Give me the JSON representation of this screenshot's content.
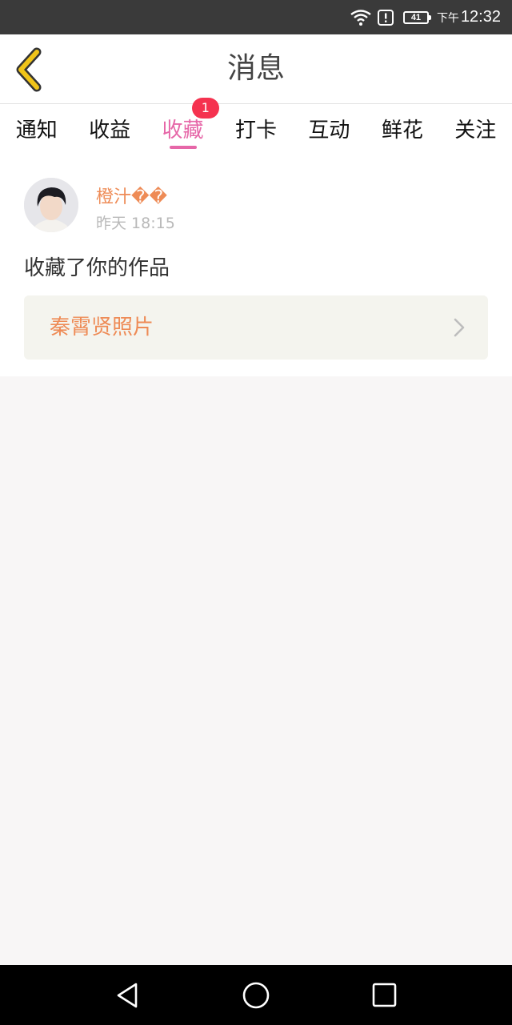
{
  "status_bar": {
    "battery": "41",
    "time_prefix": "下午",
    "time": "12:32",
    "icons": [
      "wifi-icon",
      "alert-icon",
      "battery-icon"
    ]
  },
  "header": {
    "title": "消息",
    "back_icon": "chevron-left-icon"
  },
  "tabs": [
    {
      "label": "通知"
    },
    {
      "label": "收益"
    },
    {
      "label": "收藏",
      "active": true,
      "badge": "1"
    },
    {
      "label": "打卡"
    },
    {
      "label": "互动"
    },
    {
      "label": "鲜花"
    },
    {
      "label": "关注"
    }
  ],
  "message": {
    "username": "橙汁��",
    "time": "昨天 18:15",
    "action": "收藏了你的作品",
    "work_title": "秦霄贤照片"
  },
  "nav_bar": {
    "icons": [
      "back-triangle-icon",
      "home-circle-icon",
      "recents-square-icon"
    ]
  },
  "colors": {
    "accent_pink": "#e667a8",
    "orange": "#ee8b56",
    "badge_red": "#f5324f",
    "back_arrow_yellow": "#f0c419"
  }
}
